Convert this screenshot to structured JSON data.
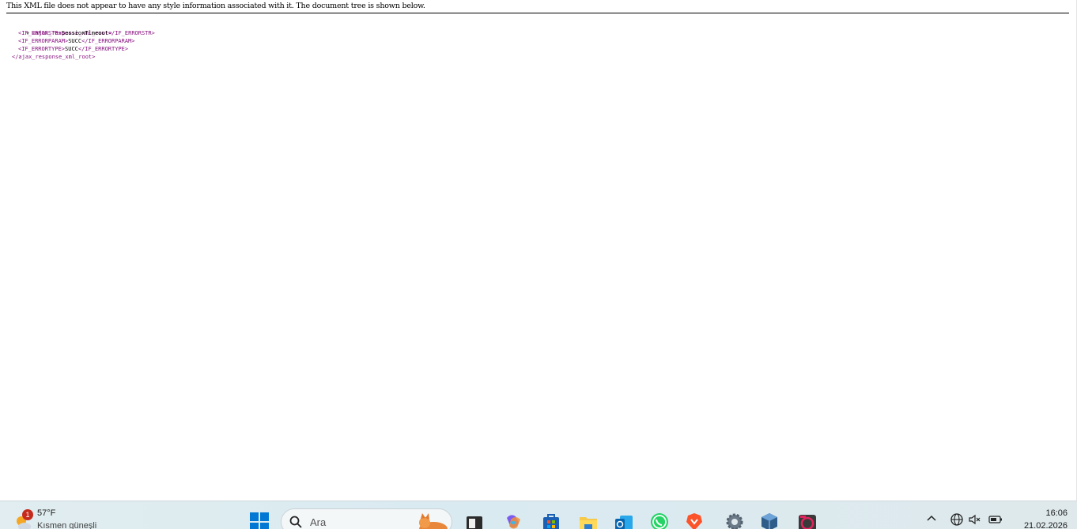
{
  "xml_viewer": {
    "notice": "This XML file does not appear to have any style information associated with it. The document tree is shown below.",
    "toggle": "▼",
    "root_open": "<ajax_response_xml_root>",
    "root_close": "</ajax_response_xml_root>",
    "nodes": [
      {
        "open": "<IF_ERRORSTR>",
        "value": "SessionTimeout",
        "close": "</IF_ERRORSTR>"
      },
      {
        "open": "<IF_ERRORPARAM>",
        "value": "SUCC",
        "close": "</IF_ERRORPARAM>"
      },
      {
        "open": "<IF_ERRORTYPE>",
        "value": "SUCC",
        "close": "</IF_ERRORTYPE>"
      }
    ]
  },
  "taskbar": {
    "weather": {
      "badge": "1",
      "temperature": "57°F",
      "description": "Kısmen güneşli"
    },
    "search": {
      "placeholder": "Ara"
    },
    "clock": {
      "time": "16:06",
      "date": "21.02.2026"
    },
    "apps": [
      "task-view",
      "copilot",
      "microsoft-store",
      "file-explorer",
      "outlook",
      "whatsapp",
      "brave",
      "settings",
      "virtualbox",
      "sniper"
    ],
    "accent_color": "#0067c0"
  }
}
